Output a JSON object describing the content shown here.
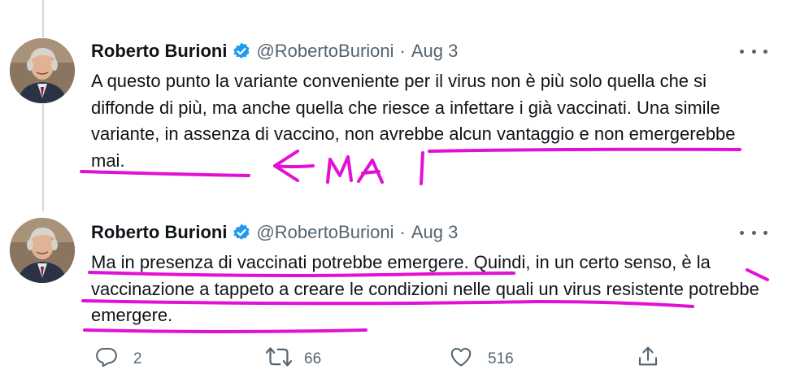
{
  "tweets": [
    {
      "author_name": "Roberto Burioni",
      "handle": "@RobertoBurioni",
      "separator": "·",
      "date": "Aug 3",
      "text": "A questo punto la variante conveniente per il virus non è più solo quella che si diffonde di più, ma anche quella che riesce a infettare i già vaccinati. Una simile variante, in assenza di vaccino, non avrebbe alcun vantaggio e non emergerebbe mai."
    },
    {
      "author_name": "Roberto Burioni",
      "handle": "@RobertoBurioni",
      "separator": "·",
      "date": "Aug 3",
      "text": "Ma in presenza di vaccinati potrebbe emergere. Quindi, in un certo senso, è la vaccinazione a tappeto a creare le condizioni nelle quali un virus resistente potrebbe emergere.",
      "actions": {
        "replies": "2",
        "retweets": "66",
        "likes": "516"
      }
    }
  ],
  "annotation": {
    "handwritten_text": "MAI",
    "color": "#e20fd6"
  },
  "colors": {
    "verified": "#1d9bf0",
    "secondary_text": "#536471",
    "thread_line": "#cfd9de"
  },
  "icons": [
    "verified-badge-icon",
    "more-options-icon",
    "reply-icon",
    "retweet-icon",
    "like-icon",
    "share-icon"
  ]
}
